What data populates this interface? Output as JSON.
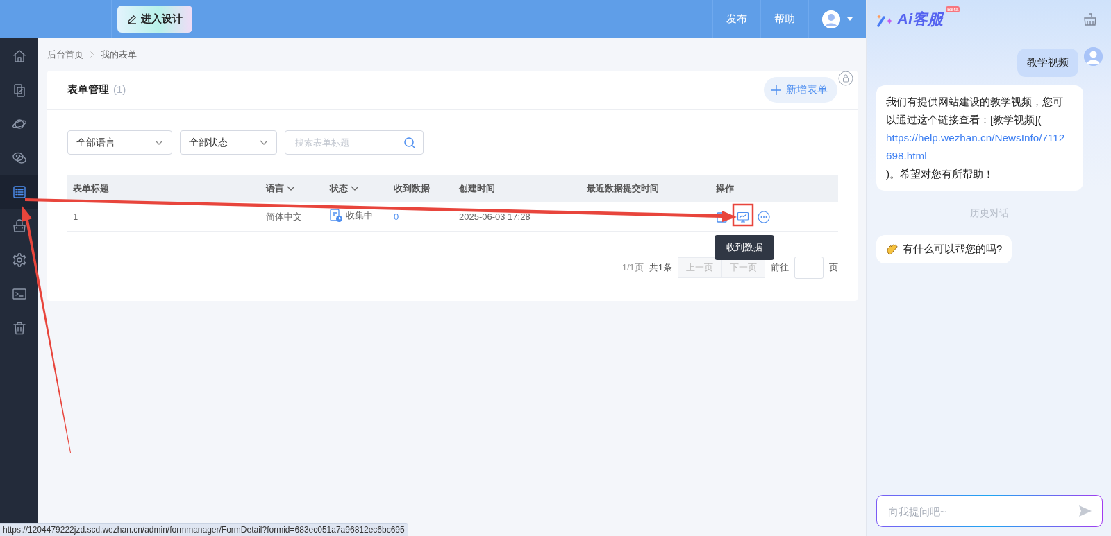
{
  "topbar": {
    "design_button": "进入设计",
    "links": [
      {
        "label": "发布"
      },
      {
        "label": "帮助"
      }
    ]
  },
  "sidebar": {
    "items": [
      {
        "kind": "home",
        "selected": false
      },
      {
        "kind": "pages",
        "selected": false
      },
      {
        "kind": "planet",
        "selected": false
      },
      {
        "kind": "chat",
        "selected": false
      },
      {
        "kind": "form",
        "selected": true
      },
      {
        "kind": "bag",
        "selected": false
      },
      {
        "kind": "gear",
        "selected": false
      },
      {
        "kind": "terminal",
        "selected": false
      },
      {
        "kind": "trash",
        "selected": false
      }
    ]
  },
  "breadcrumb": [
    "后台首页",
    "我的表单"
  ],
  "card": {
    "title": "表单管理",
    "count": "(1)",
    "add_button": "新增表单"
  },
  "filters": {
    "language": "全部语言",
    "status": "全部状态",
    "search_placeholder": "搜索表单标题"
  },
  "table": {
    "columns": [
      {
        "label": "表单标题",
        "filterable": false
      },
      {
        "label": "语言",
        "filterable": true
      },
      {
        "label": "状态",
        "filterable": true
      },
      {
        "label": "收到数据",
        "filterable": false
      },
      {
        "label": "创建时间",
        "filterable": false
      },
      {
        "label": "最近数据提交时间",
        "filterable": false
      },
      {
        "label": "操作",
        "filterable": false
      }
    ],
    "rows": [
      {
        "title": "1",
        "language": "简体中文",
        "status": "收集中",
        "received": "0",
        "created": "2025-06-03 17:28"
      }
    ]
  },
  "tooltip": "收到数据",
  "pagination": {
    "pages": "1/1页",
    "total": "共1条",
    "prev": "上一页",
    "next": "下一页",
    "goto": "前往",
    "unit": "页"
  },
  "status_url": "https://1204479222jzd.scd.wezhan.cn/admin/formmanager/FormDetail?formid=683ec051a7a96812ec6bc695",
  "assistant": {
    "title": "Ai客服",
    "badge": "Beta",
    "messages": [
      {
        "kind": "user",
        "text": "教学视频"
      },
      {
        "kind": "bot",
        "text": "我们有提供网站建设的教学视频，您可以通过这个链接查看：[教学视频](",
        "link": "https://help.wezhan.cn/NewsInfo/7112698.html",
        "text_after": ")。希望对您有所帮助！"
      }
    ],
    "history_label": "历史对话",
    "greeting": "有什么可以帮您的吗?",
    "input_placeholder": "向我提问吧~"
  }
}
